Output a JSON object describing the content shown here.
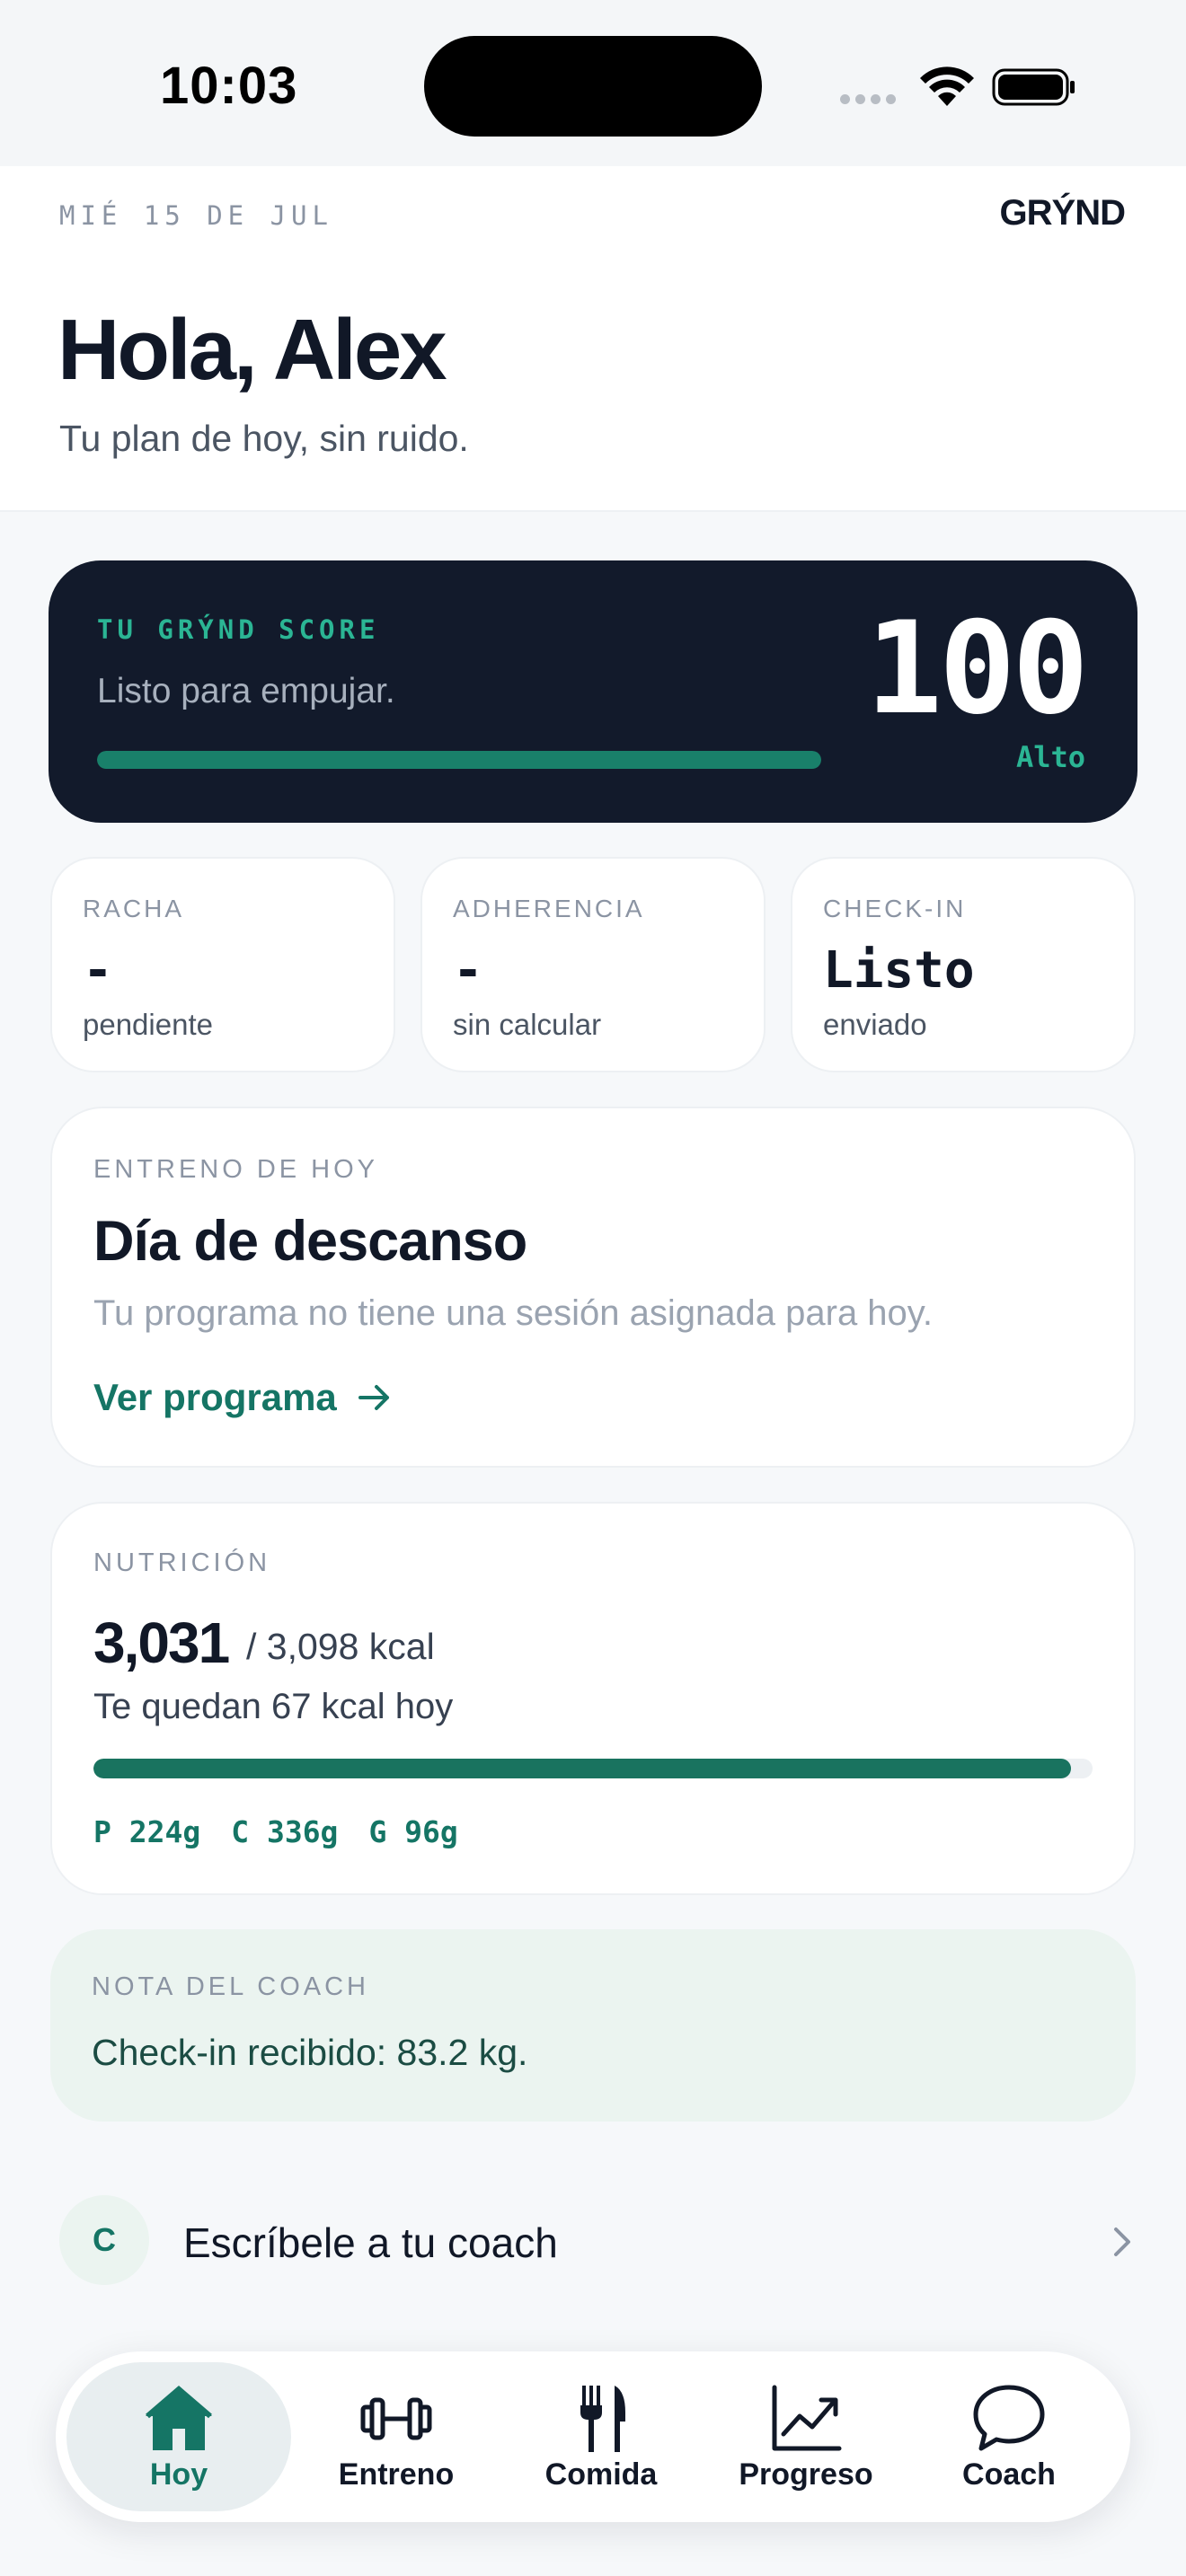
{
  "status_bar": {
    "time": "10:03"
  },
  "header": {
    "date": "MIÉ 15 DE JUL",
    "brand": "GRÝND",
    "greeting": "Hola, Alex",
    "subtitle": "Tu plan de hoy, sin ruido."
  },
  "score": {
    "label": "TU GRÝND SCORE",
    "description": "Listo para empujar.",
    "value": "100",
    "level": "Alto",
    "progress_fraction": 1.0,
    "accent_color": "#2bb594"
  },
  "stats": [
    {
      "title": "RACHA",
      "value": "-",
      "note": "pendiente"
    },
    {
      "title": "ADHERENCIA",
      "value": "-",
      "note": "sin calcular"
    },
    {
      "title": "CHECK-IN",
      "value": "Listo",
      "note": "enviado"
    }
  ],
  "workout": {
    "label": "ENTRENO DE HOY",
    "title": "Día de descanso",
    "description": "Tu programa no tiene una sesión asignada para hoy.",
    "link": "Ver programa"
  },
  "nutrition": {
    "label": "NUTRICIÓN",
    "consumed": "3,031",
    "target": "/ 3,098 kcal",
    "remaining": "Te quedan 67 kcal hoy",
    "progress_fraction": 0.978,
    "macros": [
      "P 224g",
      "C 336g",
      "G 96g"
    ]
  },
  "coach_note": {
    "label": "NOTA DEL COACH",
    "text": "Check-in recibido: 83.2 kg."
  },
  "message": {
    "avatar_letter": "C",
    "text": "Escríbele a tu coach"
  },
  "tabs": [
    {
      "label": "Hoy",
      "icon": "home-icon",
      "active": true
    },
    {
      "label": "Entreno",
      "icon": "dumbbell-icon",
      "active": false
    },
    {
      "label": "Comida",
      "icon": "fork-knife-icon",
      "active": false
    },
    {
      "label": "Progreso",
      "icon": "chart-icon",
      "active": false
    },
    {
      "label": "Coach",
      "icon": "chat-bubble-icon",
      "active": false
    }
  ],
  "colors": {
    "brand_green": "#157565",
    "dark_card": "#121a2b",
    "background": "#f6f8fa"
  }
}
